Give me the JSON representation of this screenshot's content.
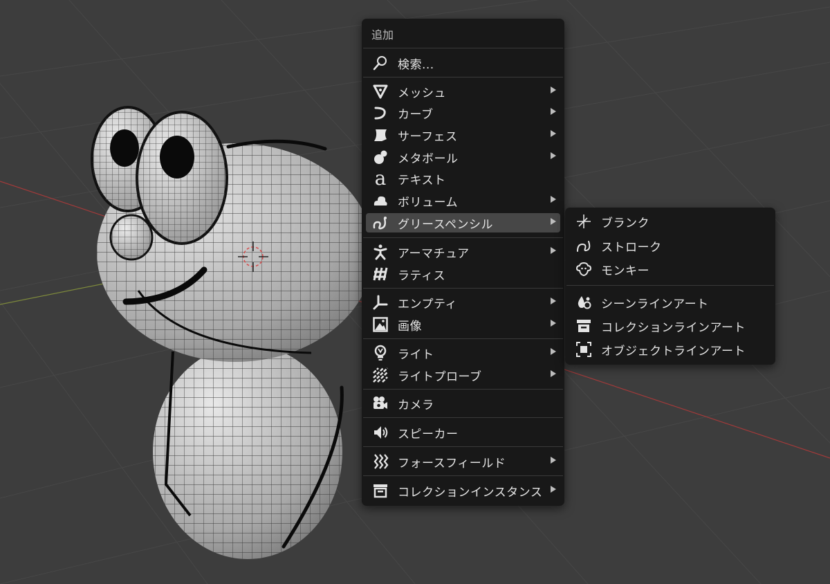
{
  "add_menu": {
    "title": "追加",
    "items": [
      {
        "label": "検索...",
        "icon": "search-icon",
        "submenu": false
      },
      {
        "label": "メッシュ",
        "icon": "mesh-icon",
        "submenu": true
      },
      {
        "label": "カーブ",
        "icon": "curve-icon",
        "submenu": true
      },
      {
        "label": "サーフェス",
        "icon": "surface-icon",
        "submenu": true
      },
      {
        "label": "メタボール",
        "icon": "metaball-icon",
        "submenu": true
      },
      {
        "label": "テキスト",
        "icon": "text-icon",
        "submenu": false
      },
      {
        "label": "ボリューム",
        "icon": "volume-icon",
        "submenu": true
      },
      {
        "label": "グリースペンシル",
        "icon": "grease-pencil-icon",
        "submenu": true,
        "highlighted": true
      },
      {
        "label": "アーマチュア",
        "icon": "armature-icon",
        "submenu": true
      },
      {
        "label": "ラティス",
        "icon": "lattice-icon",
        "submenu": false
      },
      {
        "label": "エンプティ",
        "icon": "empty-icon",
        "submenu": true
      },
      {
        "label": "画像",
        "icon": "image-icon",
        "submenu": true
      },
      {
        "label": "ライト",
        "icon": "light-icon",
        "submenu": true
      },
      {
        "label": "ライトプローブ",
        "icon": "light-probe-icon",
        "submenu": true
      },
      {
        "label": "カメラ",
        "icon": "camera-icon",
        "submenu": false
      },
      {
        "label": "スピーカー",
        "icon": "speaker-icon",
        "submenu": false
      },
      {
        "label": "フォースフィールド",
        "icon": "force-field-icon",
        "submenu": true
      },
      {
        "label": "コレクションインスタンス",
        "icon": "collection-instance-icon",
        "submenu": true
      }
    ]
  },
  "grease_pencil_submenu": {
    "items": [
      {
        "label": "ブランク",
        "icon": "blank-icon"
      },
      {
        "label": "ストローク",
        "icon": "stroke-icon"
      },
      {
        "label": "モンキー",
        "icon": "monkey-icon"
      },
      {
        "label": "シーンラインアート",
        "icon": "scene-lineart-icon"
      },
      {
        "label": "コレクションラインアート",
        "icon": "collection-lineart-icon"
      },
      {
        "label": "オブジェクトラインアート",
        "icon": "object-lineart-icon"
      }
    ]
  },
  "colors": {
    "viewport_bg": "#3d3d3d",
    "menu_bg": "#181818",
    "highlight": "#474747",
    "text": "#e4e4e4",
    "axis_red": "#a33a3a"
  }
}
